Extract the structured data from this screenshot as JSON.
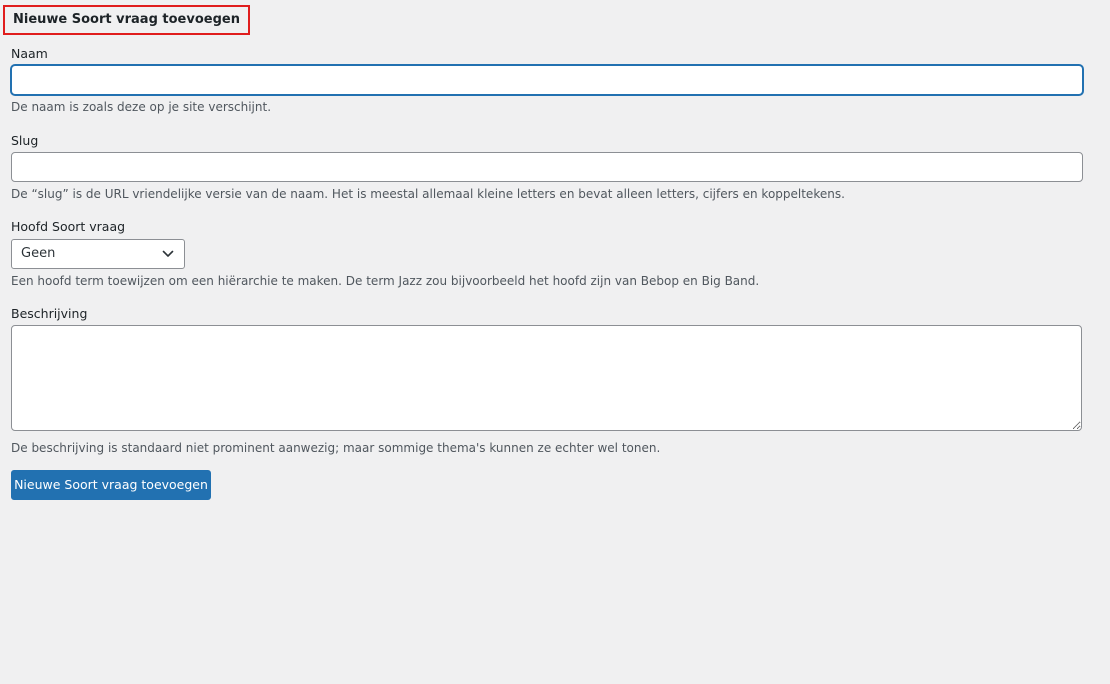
{
  "form": {
    "title": "Nieuwe Soort vraag toevoegen",
    "highlight_color": "#e01d1d",
    "name": {
      "label": "Naam",
      "value": "",
      "description": "De naam is zoals deze op je site verschijnt."
    },
    "slug": {
      "label": "Slug",
      "value": "",
      "description": "De “slug” is de URL vriendelijke versie van de naam. Het is meestal allemaal kleine letters en bevat alleen letters, cijfers en koppeltekens."
    },
    "parent": {
      "label": "Hoofd Soort vraag",
      "selected": "Geen",
      "icon": "chevron-down-icon",
      "description": "Een hoofd term toewijzen om een hiërarchie te maken. De term Jazz zou bijvoorbeeld het hoofd zijn van Bebop en Big Band."
    },
    "description_field": {
      "label": "Beschrijving",
      "value": "",
      "description": "De beschrijving is standaard niet prominent aanwezig; maar sommige thema's kunnen ze echter wel tonen."
    },
    "submit_label": "Nieuwe Soort vraag toevoegen",
    "accent_color": "#2271b1"
  }
}
